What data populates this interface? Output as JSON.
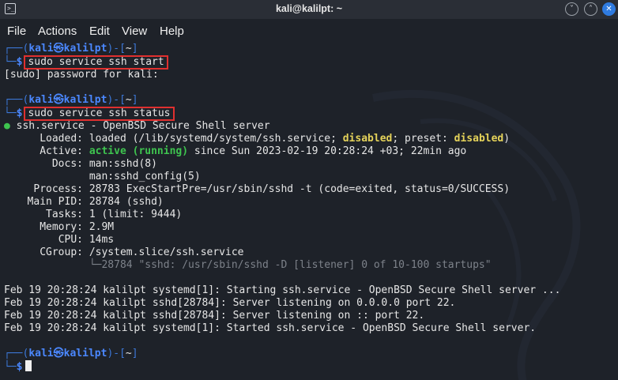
{
  "window": {
    "title": "kali@kalilpt: ~",
    "minimize_glyph": "˅",
    "maximize_glyph": "˄",
    "close_glyph": "✕",
    "terminal_icon": "terminal-icon"
  },
  "menu": {
    "file": "File",
    "actions": "Actions",
    "edit": "Edit",
    "view": "View",
    "help": "Help"
  },
  "prompt": {
    "top": "┌──(",
    "user": "kali",
    "at": "㉿",
    "host": "kalilpt",
    "close": ")-[",
    "dir": "~",
    "end": "]",
    "bottom": "└─",
    "dollar": "$"
  },
  "commands": {
    "cmd1": "sudo service ssh start",
    "cmd2": "sudo service ssh status"
  },
  "output": {
    "sudo_prompt": "[sudo] password for kali:",
    "service_dot": "●",
    "service_line": " ssh.service - OpenBSD Secure Shell server",
    "loaded_label": "Loaded:",
    "loaded_a": " loaded (/lib/systemd/system/ssh.service; ",
    "loaded_disabled1": "disabled",
    "loaded_b": "; preset: ",
    "loaded_disabled2": "disabled",
    "loaded_c": ")",
    "active_label": "Active:",
    "active_state": "active (running)",
    "active_rest": " since Sun 2023-02-19 20:28:24 +03; 22min ago",
    "docs_label": "Docs:",
    "docs1": " man:sshd(8)",
    "docs2": "man:sshd_config(5)",
    "process_label": "Process:",
    "process_value": " 28783 ExecStartPre=/usr/sbin/sshd -t (code=exited, status=0/SUCCESS)",
    "mainpid_label": "Main PID:",
    "mainpid_value": " 28784 (sshd)",
    "tasks_label": "Tasks:",
    "tasks_value": " 1 (limit: 9444)",
    "memory_label": "Memory:",
    "memory_value": " 2.9M",
    "cpu_label": "CPU:",
    "cpu_value": " 14ms",
    "cgroup_label": "CGroup:",
    "cgroup_value": " /system.slice/ssh.service",
    "cgroup_child": "└─28784 \"sshd: /usr/sbin/sshd -D [listener] 0 of 10-100 startups\"",
    "log1": "Feb 19 20:28:24 kalilpt systemd[1]: Starting ssh.service - OpenBSD Secure Shell server ...",
    "log2": "Feb 19 20:28:24 kalilpt sshd[28784]: Server listening on 0.0.0.0 port 22.",
    "log3": "Feb 19 20:28:24 kalilpt sshd[28784]: Server listening on :: port 22.",
    "log4": "Feb 19 20:28:24 kalilpt systemd[1]: Started ssh.service - OpenBSD Secure Shell server."
  },
  "colors": {
    "background": "#1e2229",
    "prompt_blue": "#3c78d8",
    "active_green": "#3ec44f",
    "disabled_yellow": "#e5d35a",
    "highlight_red": "#e0302f",
    "close_button": "#2f7be0"
  }
}
